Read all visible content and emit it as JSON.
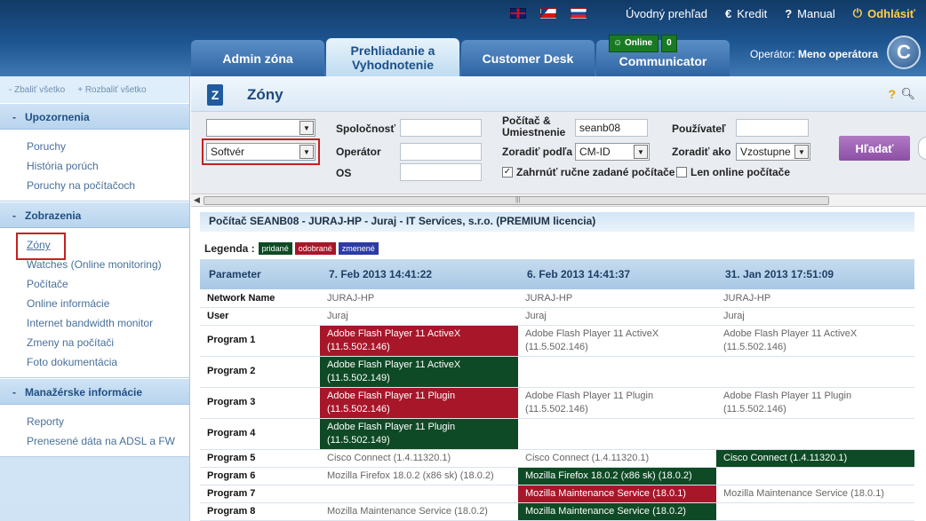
{
  "header": {
    "languages": [
      {
        "code": "en",
        "icon": "uk-flag-icon"
      },
      {
        "code": "cz",
        "icon": "cz-flag-icon"
      },
      {
        "code": "sk",
        "icon": "sk-flag-icon"
      }
    ],
    "links": {
      "overview": "Úvodný prehľad",
      "credit": "Kredit",
      "manual": "Manual",
      "logout": "Odhlásiť"
    },
    "tabs": [
      {
        "label": "Admin zóna"
      },
      {
        "label": "Prehliadanie a Vyhodnotenie",
        "active": true
      },
      {
        "label": "Customer Desk"
      },
      {
        "label": "Communicator"
      }
    ],
    "online_badge": {
      "label": "Online",
      "count": "0"
    },
    "operator_label": "Operátor:",
    "operator_name": "Meno operátora",
    "logo_letter": "C"
  },
  "sidebar": {
    "collapse_all": "- Zbaliť všetko",
    "expand_all": "+ Rozbaliť všetko",
    "sections": [
      {
        "title": "Upozornenia",
        "items": [
          "Poruchy",
          "História porúch",
          "Poruchy na počítačoch"
        ]
      },
      {
        "title": "Zobrazenia",
        "items": [
          "Zóny",
          "Watches (Online monitoring)",
          "Počítače",
          "Online informácie",
          "Internet bandwidth monitor",
          "Zmeny na počítači",
          "Foto dokumentácia"
        ],
        "current": "Zóny"
      },
      {
        "title": "Manažérske informácie",
        "items": [
          "Reporty",
          "Prenesené dáta na ADSL a FW"
        ]
      }
    ]
  },
  "page": {
    "title": "Zóny",
    "filters": {
      "select1_value": "",
      "select2_value": "Softvér",
      "company_label": "Spoločnosť",
      "operator_label": "Operátor",
      "os_label": "OS",
      "pc_location_label": "Počítač & Umiestnenie",
      "pc_location_value": "seanb08",
      "sort_by_label": "Zoradiť podľa",
      "sort_by_value": "CM-ID",
      "user_label": "Používateľ",
      "sort_as_label": "Zoradiť ako",
      "sort_as_value": "Vzostupne",
      "include_manual": "Zahrnúť ručne zadané počítače",
      "include_manual_checked": true,
      "online_only": "Len online počítače",
      "online_only_checked": false,
      "search_button": "Hľadať"
    },
    "pc_title": "Počítač SEANB08 - JURAJ-HP - Juraj - IT Services, s.r.o. (PREMIUM licencia)",
    "legend": {
      "label": "Legenda :",
      "added": "pridané",
      "removed": "odobrané",
      "changed": "zmenené",
      "colors": {
        "added": "#0e4a25",
        "removed": "#a8162a",
        "changed": "#2d3ba4"
      }
    },
    "table": {
      "headers": [
        "Parameter",
        "7. Feb 2013 14:41:22",
        "6. Feb 2013 14:41:37",
        "31. Jan 2013 17:51:09"
      ],
      "rows": [
        {
          "param": "Network Name",
          "cells": [
            "JURAJ-HP",
            "JURAJ-HP",
            "JURAJ-HP"
          ],
          "states": [
            "",
            "",
            ""
          ]
        },
        {
          "param": "User",
          "cells": [
            "Juraj",
            "Juraj",
            "Juraj"
          ],
          "states": [
            "",
            "",
            ""
          ]
        },
        {
          "param": "Program 1",
          "cells": [
            "Adobe Flash Player 11 ActiveX\n(11.5.502.146)",
            "Adobe Flash Player 11 ActiveX\n(11.5.502.146)",
            "Adobe Flash Player 11 ActiveX\n(11.5.502.146)"
          ],
          "states": [
            "rem",
            "",
            ""
          ]
        },
        {
          "param": "Program 2",
          "cells": [
            "Adobe Flash Player 11 ActiveX\n(11.5.502.149)",
            "",
            ""
          ],
          "states": [
            "add",
            "",
            ""
          ]
        },
        {
          "param": "Program 3",
          "cells": [
            "Adobe Flash Player 11 Plugin\n(11.5.502.146)",
            "Adobe Flash Player 11 Plugin\n(11.5.502.146)",
            "Adobe Flash Player 11 Plugin\n(11.5.502.146)"
          ],
          "states": [
            "rem",
            "",
            ""
          ]
        },
        {
          "param": "Program 4",
          "cells": [
            "Adobe Flash Player 11 Plugin\n(11.5.502.149)",
            "",
            ""
          ],
          "states": [
            "add",
            "",
            ""
          ]
        },
        {
          "param": "Program 5",
          "cells": [
            "Cisco Connect (1.4.11320.1)",
            "Cisco Connect (1.4.11320.1)",
            "Cisco Connect (1.4.11320.1)"
          ],
          "states": [
            "",
            "",
            "add"
          ]
        },
        {
          "param": "Program 6",
          "cells": [
            "Mozilla Firefox 18.0.2 (x86 sk) (18.0.2)",
            "Mozilla Firefox 18.0.2 (x86 sk) (18.0.2)",
            ""
          ],
          "states": [
            "",
            "add",
            ""
          ]
        },
        {
          "param": "Program 7",
          "cells": [
            "",
            "Mozilla Maintenance Service (18.0.1)",
            "Mozilla Maintenance Service (18.0.1)"
          ],
          "states": [
            "",
            "rem",
            ""
          ]
        },
        {
          "param": "Program 8",
          "cells": [
            "Mozilla Maintenance Service (18.0.2)",
            "Mozilla Maintenance Service (18.0.2)",
            ""
          ],
          "states": [
            "",
            "add",
            ""
          ]
        }
      ]
    }
  }
}
